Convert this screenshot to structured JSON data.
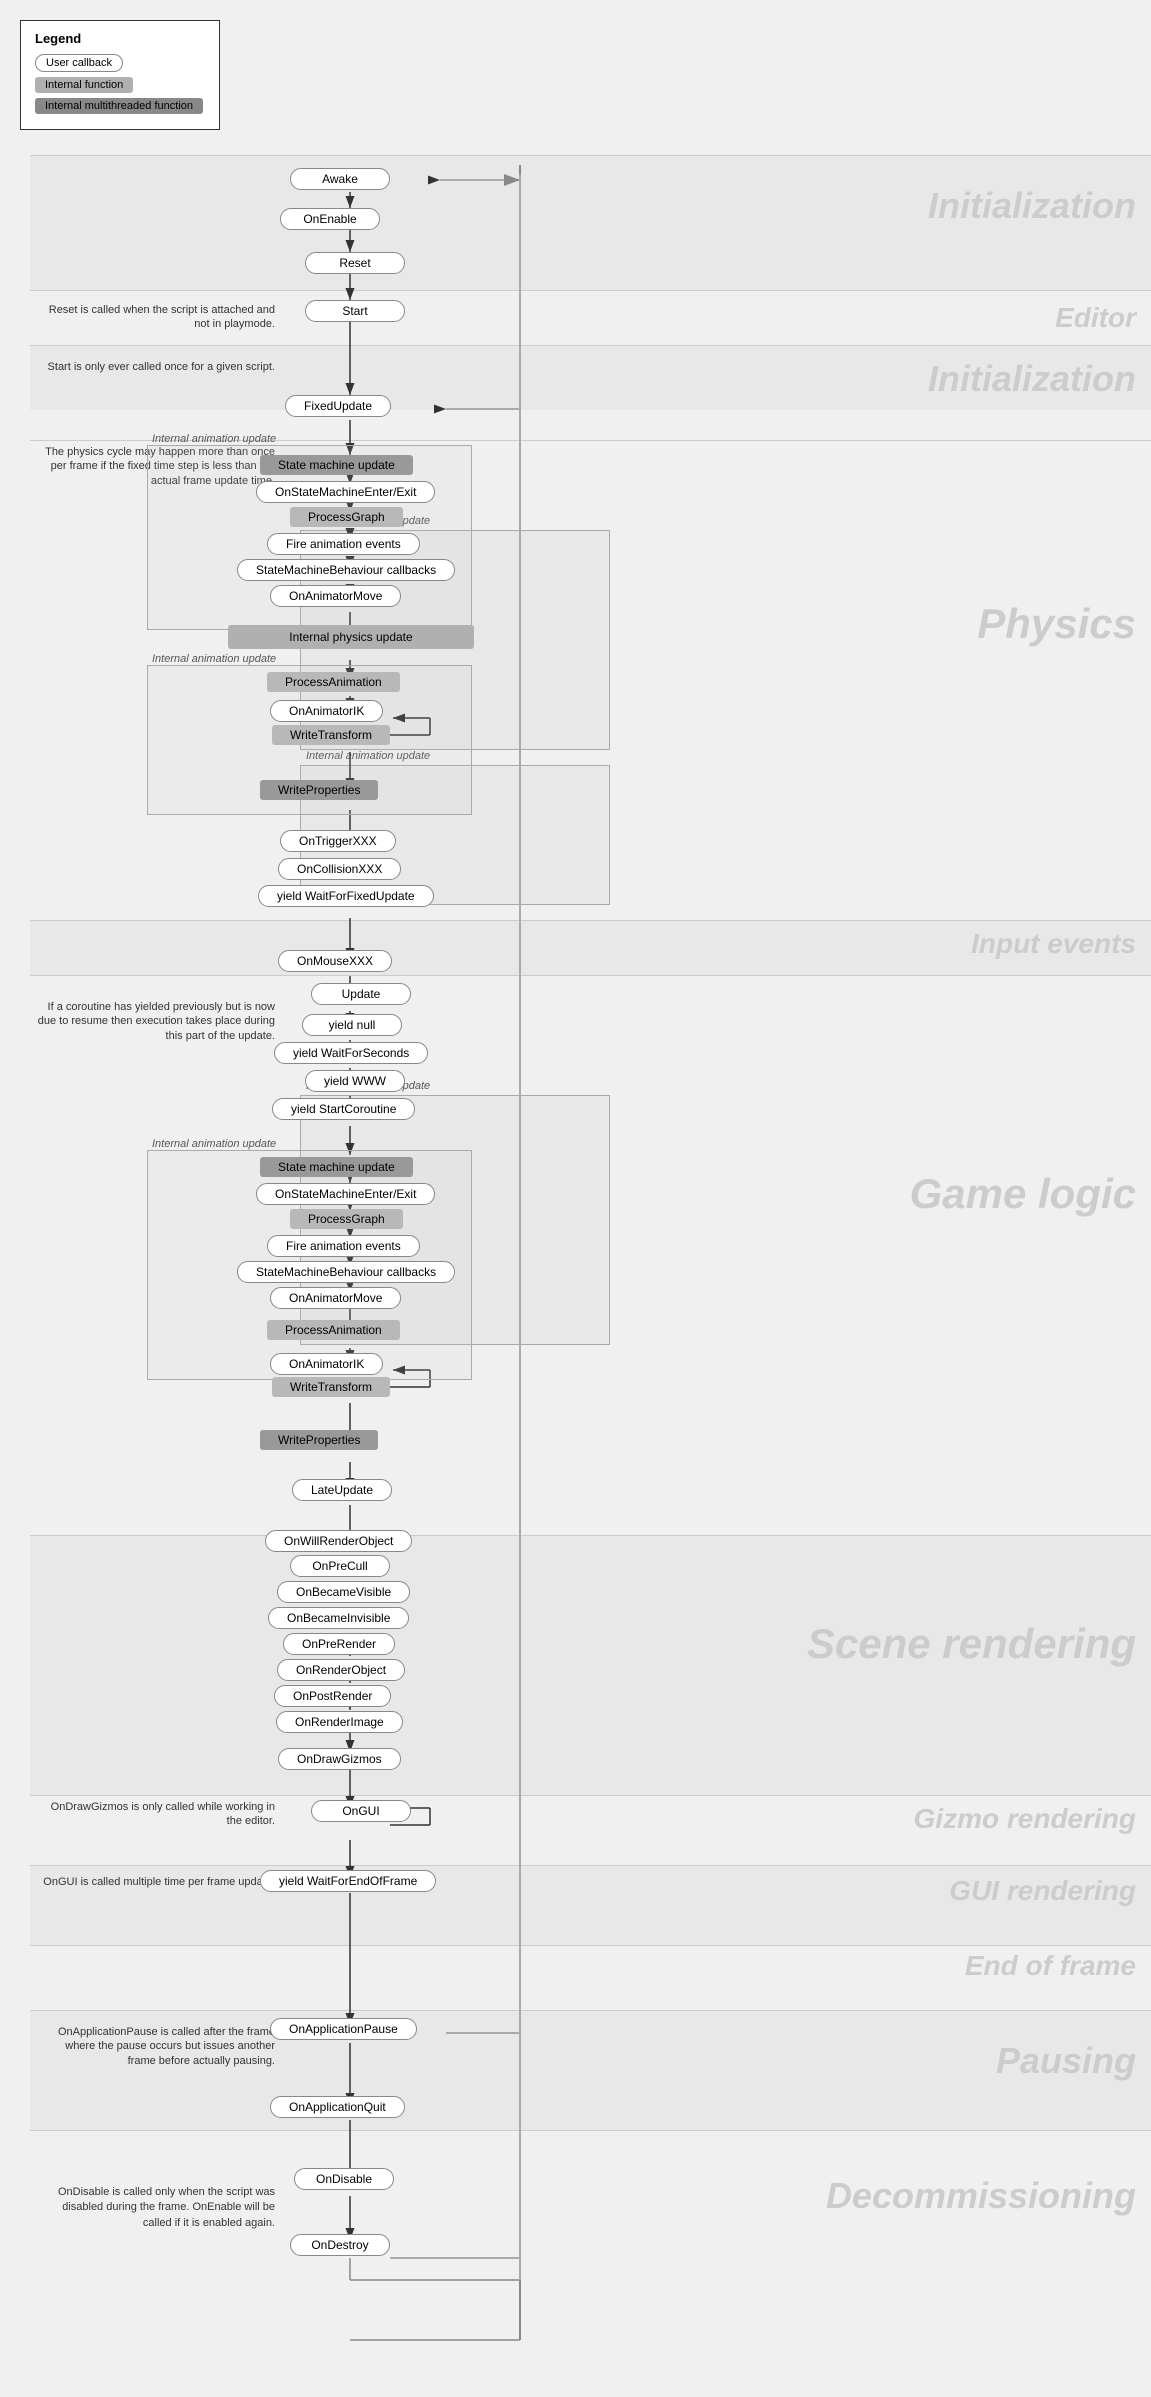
{
  "legend": {
    "title": "Legend",
    "items": [
      {
        "label": "User callback",
        "type": "user-callback"
      },
      {
        "label": "Internal function",
        "type": "internal-fn"
      },
      {
        "label": "Internal multithreaded function",
        "type": "internal-mt"
      }
    ]
  },
  "sections": [
    {
      "id": "init1",
      "label": "Initialization"
    },
    {
      "id": "editor",
      "label": "Editor"
    },
    {
      "id": "init2",
      "label": "Initialization"
    },
    {
      "id": "physics",
      "label": "Physics"
    },
    {
      "id": "input",
      "label": "Input events"
    },
    {
      "id": "gamelogic",
      "label": "Game logic"
    },
    {
      "id": "scenerender",
      "label": "Scene rendering"
    },
    {
      "id": "gizmo",
      "label": "Gizmo rendering"
    },
    {
      "id": "gui",
      "label": "GUI rendering"
    },
    {
      "id": "eof",
      "label": "End of frame"
    },
    {
      "id": "pausing",
      "label": "Pausing"
    },
    {
      "id": "decommission",
      "label": "Decommissioning"
    }
  ],
  "annotations": [
    {
      "id": "reset-note",
      "text": "Reset is called when the script is attached and not in playmode."
    },
    {
      "id": "start-note",
      "text": "Start is only ever called once for a given script."
    },
    {
      "id": "physics-note",
      "text": "The physics cycle may happen more than once per frame if the fixed time step is less than the actual frame update time."
    },
    {
      "id": "coroutine-note",
      "text": "If a coroutine has yielded previously but is now due to resume then execution takes place during this part of the update."
    },
    {
      "id": "ondrawgizmos-note",
      "text": "OnDrawGizmos is only called while working in the editor."
    },
    {
      "id": "ongui-note",
      "text": "OnGUI is called multiple time per frame update."
    },
    {
      "id": "onapppause-note",
      "text": "OnApplicationPause is called after the frame where the pause occurs but issues another frame before actually pausing."
    },
    {
      "id": "ondisable-note",
      "text": "OnDisable is called only when the script was disabled during the frame. OnEnable will be called if it is enabled again."
    }
  ],
  "nodes": {
    "awake": "Awake",
    "onenable": "OnEnable",
    "reset": "Reset",
    "start": "Start",
    "fixedupdate": "FixedUpdate",
    "state_machine_update_1": "State machine update",
    "onstatemachineenter_exit_1": "OnStateMachineEnter/Exit",
    "processgraph_1": "ProcessGraph",
    "fire_anim_events_1": "Fire animation events",
    "statemachinebehaviour_1": "StateMachineBehaviour callbacks",
    "onanimatormove_1": "OnAnimatorMove",
    "internal_physics_update": "Internal physics update",
    "processanimation_1": "ProcessAnimation",
    "onanimatorik_1": "OnAnimatorIK",
    "writetransform_1": "WriteTransform",
    "writeproperties_1": "WriteProperties",
    "ontriggerxxx": "OnTriggerXXX",
    "oncollisionxxx": "OnCollisionXXX",
    "yield_waitforfixedupdate": "yield WaitForFixedUpdate",
    "onmousexxx": "OnMouseXXX",
    "update": "Update",
    "yield_null": "yield null",
    "yield_waitforseconds": "yield WaitForSeconds",
    "yield_www": "yield WWW",
    "yield_startcoroutine": "yield StartCoroutine",
    "state_machine_update_2": "State machine update",
    "onstatemachineenter_exit_2": "OnStateMachineEnter/Exit",
    "processgraph_2": "ProcessGraph",
    "fire_anim_events_2": "Fire animation events",
    "statemachinebehaviour_2": "StateMachineBehaviour callbacks",
    "onanimatormove_2": "OnAnimatorMove",
    "processanimation_2": "ProcessAnimation",
    "onanimatorik_2": "OnAnimatorIK",
    "writetransform_2": "WriteTransform",
    "writeproperties_2": "WriteProperties",
    "lateupdate": "LateUpdate",
    "onwillrenderobject": "OnWillRenderObject",
    "onprecull": "OnPreCull",
    "onbecamevisible": "OnBecameVisible",
    "onbecameinvisible": "OnBecameInvisible",
    "onprerender": "OnPreRender",
    "onrenderobject": "OnRenderObject",
    "onpostrender": "OnPostRender",
    "onrenderimage": "OnRenderImage",
    "ondrawgizmos": "OnDrawGizmos",
    "ongui": "OnGUI",
    "yield_waitforendofframe": "yield WaitForEndOfFrame",
    "onapplicationpause": "OnApplicationPause",
    "onapplicationquit": "OnApplicationQuit",
    "ondisable": "OnDisable",
    "ondestroy": "OnDestroy",
    "internal_anim_update_label": "Internal animation update",
    "internal_physics_update_label": "Internal physics update",
    "internal_anim_update_label_2": "Internal animation update"
  }
}
